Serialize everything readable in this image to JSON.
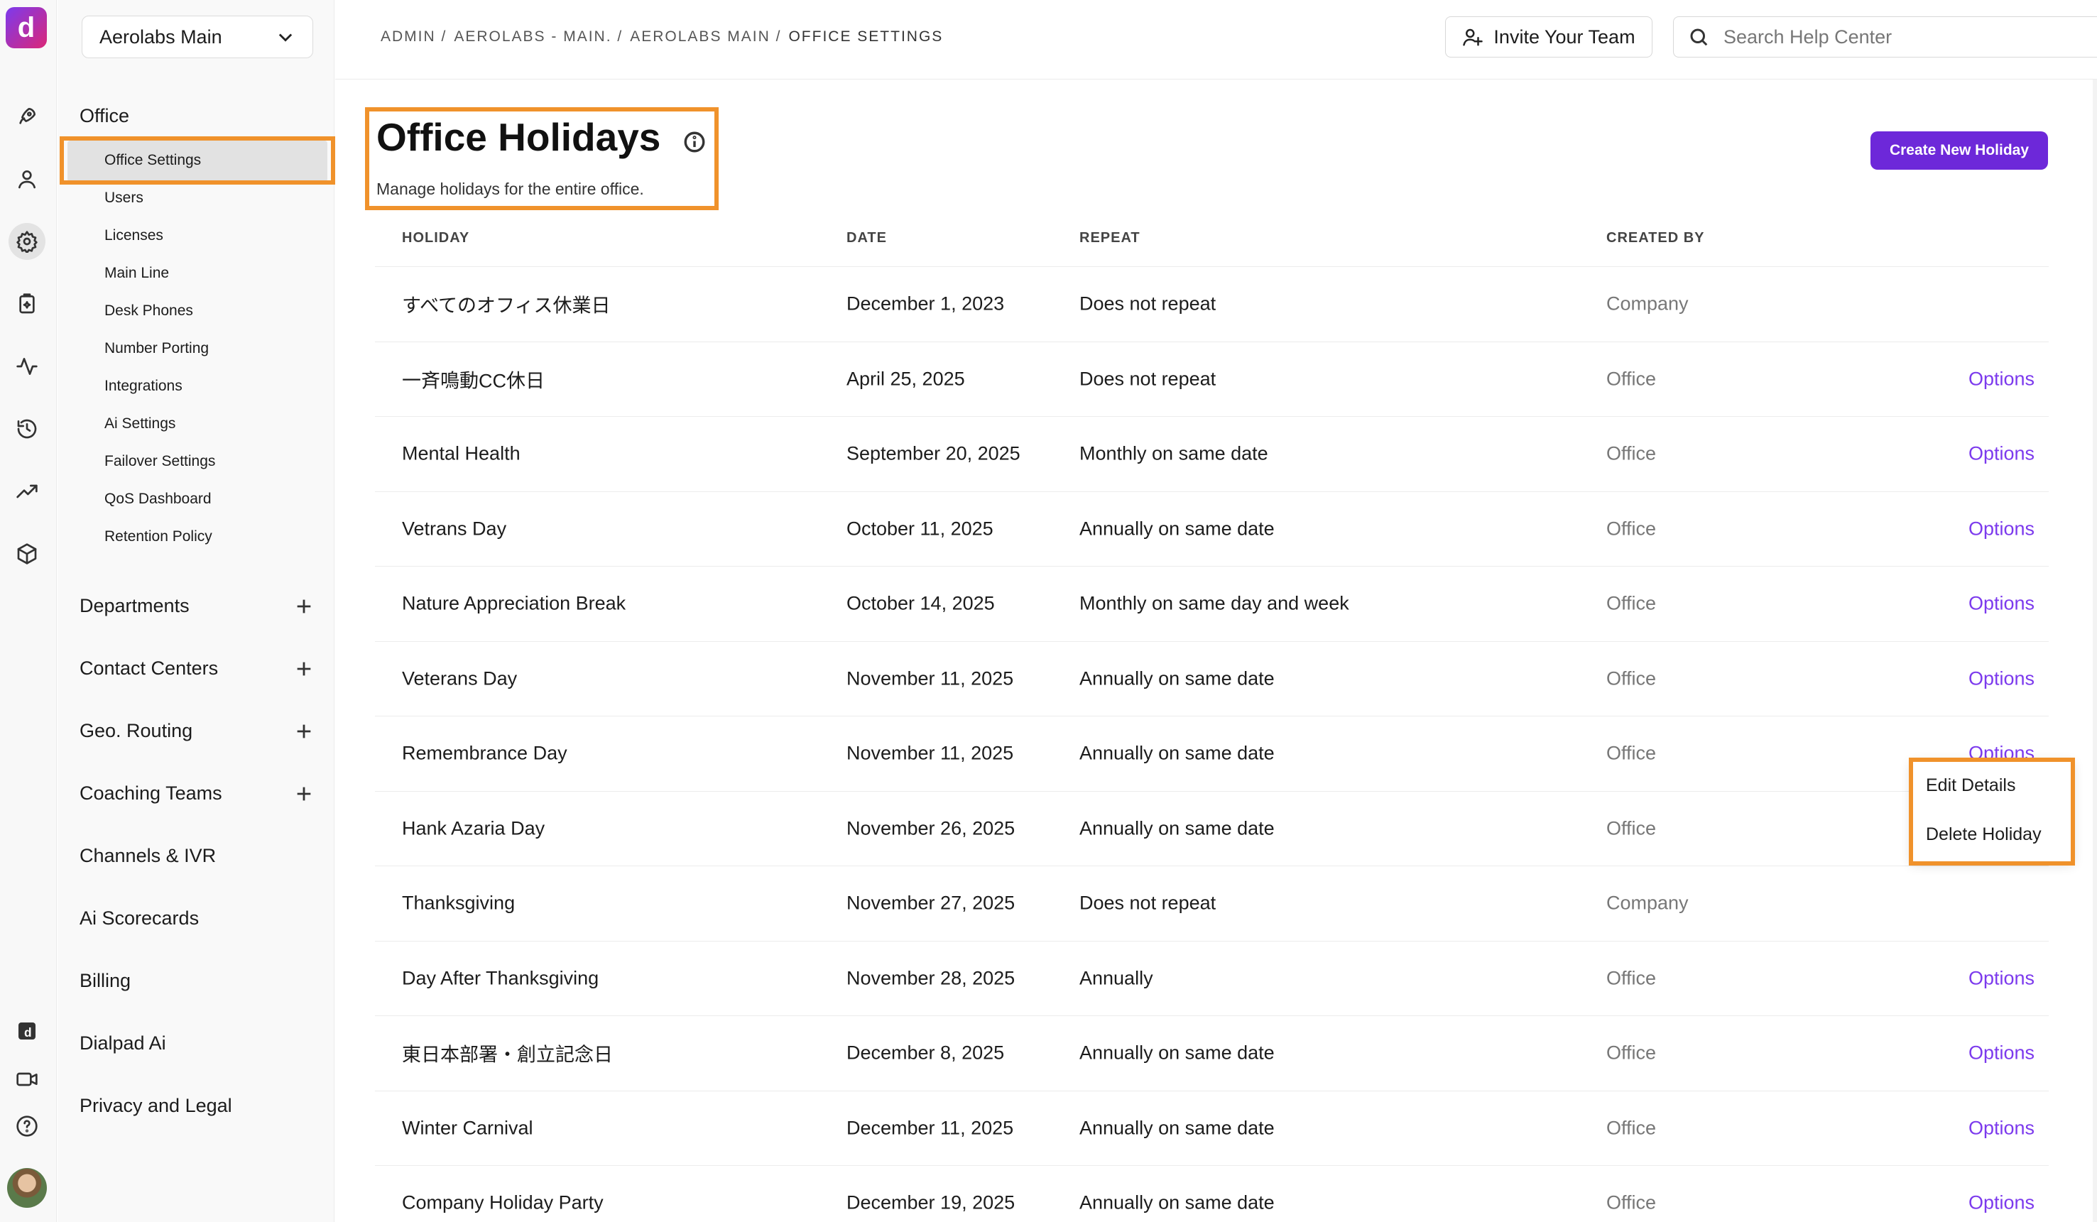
{
  "app": {
    "logo_glyph": "d",
    "accent": "#6d28d9",
    "highlight": "#f0922b"
  },
  "rail": {
    "icons": [
      "rocket-icon",
      "person-icon",
      "gear-icon",
      "clipboard-icon",
      "activity-icon",
      "history-icon",
      "trending-up-icon",
      "cube-icon",
      "dialpad-logo-icon",
      "video-icon",
      "help-icon"
    ],
    "active": "gear-icon"
  },
  "nav": {
    "org_select": "Aerolabs Main",
    "section": "Office",
    "sub_items": [
      "Office Settings",
      "Users",
      "Licenses",
      "Main Line",
      "Desk Phones",
      "Number Porting",
      "Integrations",
      "Ai Settings",
      "Failover Settings",
      "QoS Dashboard",
      "Retention Policy"
    ],
    "groups": [
      {
        "label": "Departments",
        "expandable": true
      },
      {
        "label": "Contact Centers",
        "expandable": true
      },
      {
        "label": "Geo. Routing",
        "expandable": true
      },
      {
        "label": "Coaching Teams",
        "expandable": true
      },
      {
        "label": "Channels & IVR",
        "expandable": false
      },
      {
        "label": "Ai Scorecards",
        "expandable": false
      },
      {
        "label": "Billing",
        "expandable": false
      },
      {
        "label": "Dialpad Ai",
        "expandable": false
      },
      {
        "label": "Privacy and Legal",
        "expandable": false
      }
    ]
  },
  "header": {
    "breadcrumb": [
      "ADMIN /",
      "AEROLABS - MAIN. /",
      "AEROLABS MAIN /",
      "OFFICE SETTINGS"
    ],
    "invite_label": "Invite Your Team",
    "search_placeholder": "Search Help Center"
  },
  "page": {
    "title": "Office Holidays",
    "subtitle": "Manage holidays for the entire office.",
    "create_label": "Create New Holiday"
  },
  "table": {
    "headers": [
      "HOLIDAY",
      "DATE",
      "REPEAT",
      "CREATED BY"
    ],
    "options_label": "Options",
    "rows": [
      {
        "holiday": "すべてのオフィス休業日",
        "date": "December 1, 2023",
        "repeat": "Does not repeat",
        "created_by": "Company",
        "options": ""
      },
      {
        "holiday": "一斉鳴動CC休日",
        "date": "April 25, 2025",
        "repeat": "Does not repeat",
        "created_by": "Office",
        "options": "Options"
      },
      {
        "holiday": "Mental Health",
        "date": "September 20, 2025",
        "repeat": "Monthly on same date",
        "created_by": "Office",
        "options": "Options"
      },
      {
        "holiday": "Vetrans Day",
        "date": "October 11, 2025",
        "repeat": "Annually on same date",
        "created_by": "Office",
        "options": "Options"
      },
      {
        "holiday": "Nature Appreciation Break",
        "date": "October 14, 2025",
        "repeat": "Monthly on same day and week",
        "created_by": "Office",
        "options": "Options"
      },
      {
        "holiday": "Veterans Day",
        "date": "November 11, 2025",
        "repeat": "Annually on same date",
        "created_by": "Office",
        "options": "Options"
      },
      {
        "holiday": "Remembrance Day",
        "date": "November 11, 2025",
        "repeat": "Annually on same date",
        "created_by": "Office",
        "options": "Options"
      },
      {
        "holiday": "Hank Azaria Day",
        "date": "November 26, 2025",
        "repeat": "Annually on same date",
        "created_by": "Office",
        "options": ""
      },
      {
        "holiday": "Thanksgiving",
        "date": "November 27, 2025",
        "repeat": "Does not repeat",
        "created_by": "Company",
        "options": ""
      },
      {
        "holiday": "Day After Thanksgiving",
        "date": "November 28, 2025",
        "repeat": "Annually",
        "created_by": "Office",
        "options": "Options"
      },
      {
        "holiday": "東日本部署・創立記念日",
        "date": "December 8, 2025",
        "repeat": "Annually on same date",
        "created_by": "Office",
        "options": "Options"
      },
      {
        "holiday": "Winter Carnival",
        "date": "December 11, 2025",
        "repeat": "Annually on same date",
        "created_by": "Office",
        "options": "Options"
      },
      {
        "holiday": "Company Holiday Party",
        "date": "December 19, 2025",
        "repeat": "Annually on same date",
        "created_by": "Office",
        "options": "Options"
      }
    ]
  },
  "dropdown": {
    "items": [
      "Edit Details",
      "Delete Holiday"
    ]
  }
}
